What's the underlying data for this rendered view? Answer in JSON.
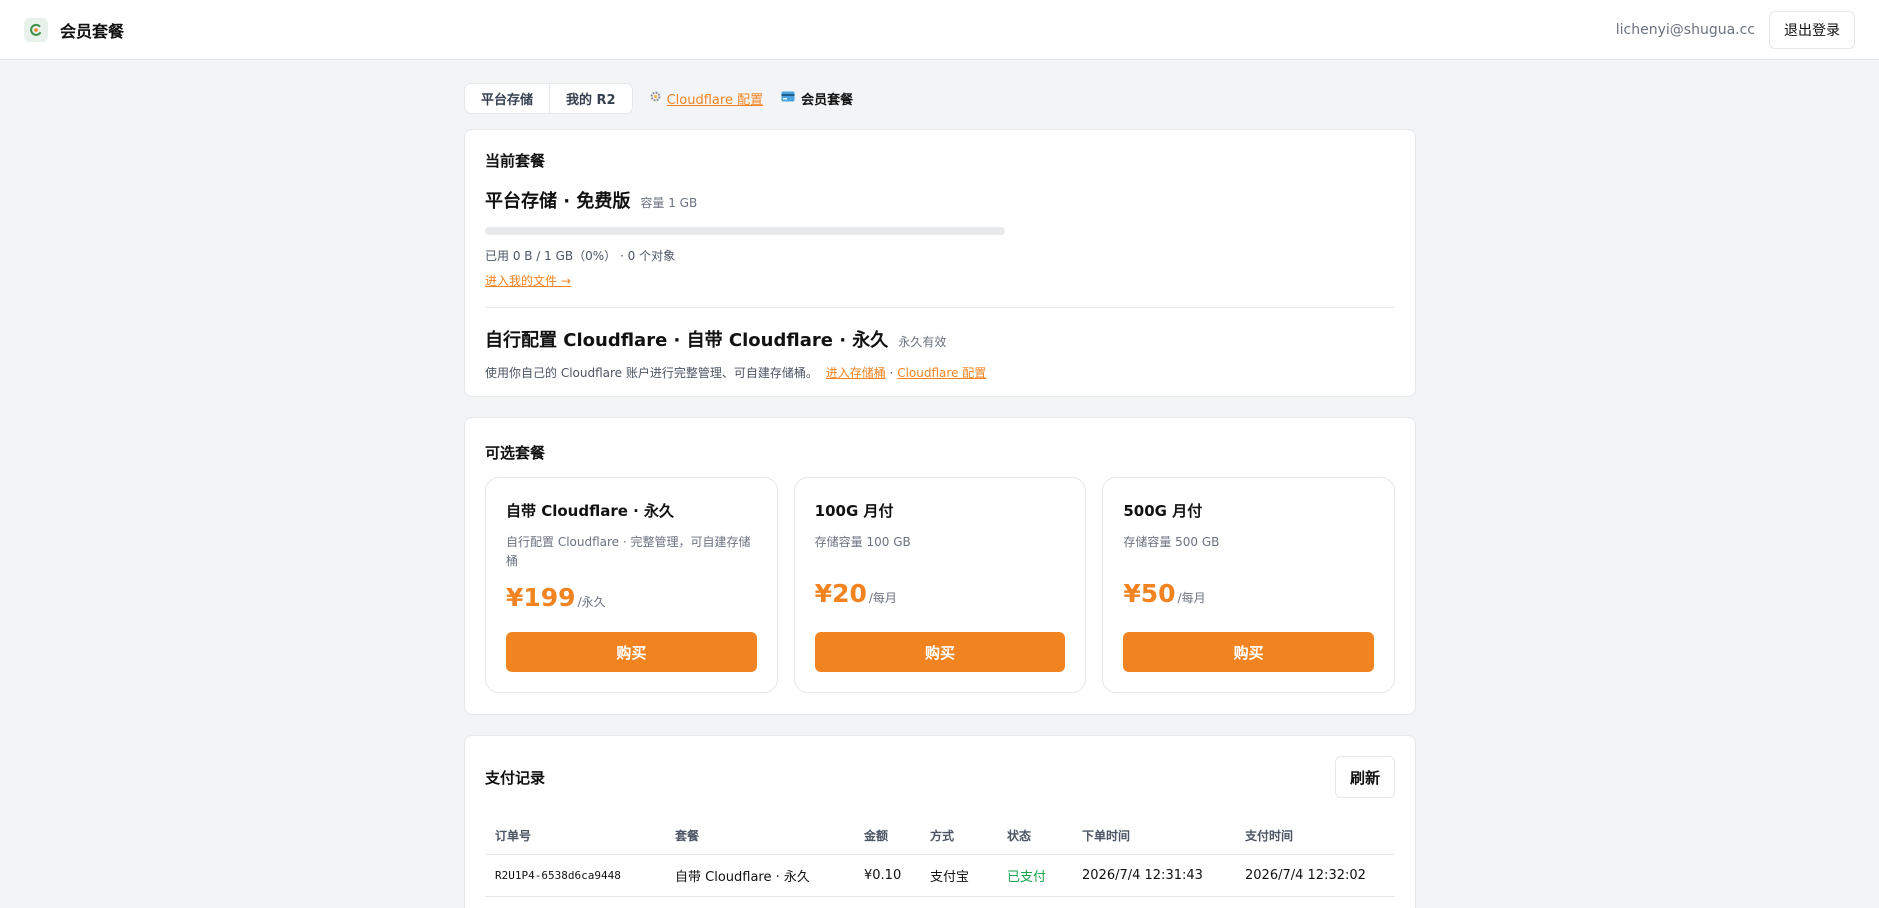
{
  "header": {
    "title": "会员套餐",
    "user_email": "lichenyi@shugua.cc",
    "logout_label": "退出登录"
  },
  "tabs": {
    "platform_storage": "平台存储",
    "my_r2": "我的 R2",
    "cloudflare_config": "Cloudflare 配置",
    "membership": "会员套餐"
  },
  "current_plan": {
    "section_title": "当前套餐",
    "platform": {
      "name": "平台存储 · 免费版",
      "capacity": "容量 1 GB",
      "usage_fraction": 0,
      "usage_text": "已用 0 B / 1 GB（0%） · 0 个对象",
      "files_link": "进入我的文件 →"
    },
    "self_hosted": {
      "name": "自行配置 Cloudflare · 自带 Cloudflare · 永久",
      "validity": "永久有效",
      "description": "使用你自己的 Cloudflare 账户进行完整管理、可自建存储桶。",
      "storage_link": "进入存储桶",
      "separator": "·",
      "config_link": "Cloudflare 配置"
    }
  },
  "available_plans": {
    "section_title": "可选套餐",
    "plans": [
      {
        "title": "自带 Cloudflare · 永久",
        "description": "自行配置 Cloudflare · 完整管理，可自建存储桶",
        "price": "¥199",
        "period": "/永久",
        "buy_label": "购买"
      },
      {
        "title": "100G 月付",
        "description": "存储容量 100 GB",
        "price": "¥20",
        "period": "/每月",
        "buy_label": "购买"
      },
      {
        "title": "500G 月付",
        "description": "存储容量 500 GB",
        "price": "¥50",
        "period": "/每月",
        "buy_label": "购买"
      }
    ]
  },
  "payments": {
    "section_title": "支付记录",
    "refresh_label": "刷新",
    "columns": [
      "订单号",
      "套餐",
      "金额",
      "方式",
      "状态",
      "下单时间",
      "支付时间"
    ],
    "rows": [
      [
        "R2U1P4-6538d6ca9448",
        "自带 Cloudflare · 永久",
        "¥0.10",
        "支付宝",
        "已支付",
        "2026/7/4 12:31:43",
        "2026/7/4 12:32:02"
      ]
    ]
  },
  "colors": {
    "accent": "#f28321",
    "paid": "#16a34a"
  }
}
